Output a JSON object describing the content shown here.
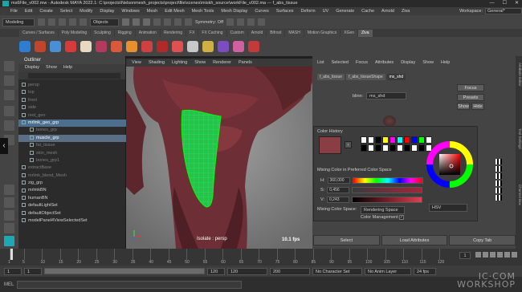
{
  "titlebar": {
    "title": "ms6File_v002.mw - Autodesk MAYA 2022.1: C:\\projects\\Nelsonmesh_projects\\project\\file\\scenes\\miskh_source\\workFile_v002.ma --- f_abs_tissue"
  },
  "window_controls": [
    "—",
    "☐",
    "✕"
  ],
  "menubar": {
    "items": [
      "File",
      "Edit",
      "Create",
      "Select",
      "Modify",
      "Display",
      "Windows",
      "Mesh",
      "Edit Mesh",
      "Mesh Tools",
      "Mesh Display",
      "Curves",
      "Surfaces",
      "Deform",
      "UV",
      "Generate",
      "Cache",
      "Arnold",
      "Ziva"
    ],
    "workspace_label": "Workspace:",
    "workspace_value": "General*"
  },
  "statusline": {
    "mode": "Modeling",
    "selection": "Objects",
    "symmetry": "Symmetry: Off"
  },
  "shelf_tabs": [
    "Curves / Surfaces",
    "Poly Modeling",
    "Sculpting",
    "Rigging",
    "Animation",
    "Rendering",
    "FX",
    "FX Caching",
    "Custom",
    "Arnold",
    "Bifrost",
    "MASH",
    "Motion Graphics",
    "XGen",
    "Ziva"
  ],
  "shelf_active_tab": "Ziva",
  "outliner": {
    "title": "Outliner",
    "menu": [
      "Display",
      "Show",
      "Help"
    ],
    "items": [
      {
        "label": "persp",
        "style": "dim"
      },
      {
        "label": "top",
        "style": "dim"
      },
      {
        "label": "front",
        "style": "dim"
      },
      {
        "label": "side",
        "style": "dim"
      },
      {
        "label": "rest_geo",
        "style": "dim"
      },
      {
        "label": "mrlmk_geo_grp",
        "style": "sel"
      },
      {
        "label": "bones_grp",
        "style": "dim"
      },
      {
        "label": "muscle_grp",
        "style": "hl"
      },
      {
        "label": "fat_tissue",
        "style": "dim"
      },
      {
        "label": "skin_mesh",
        "style": "dim"
      },
      {
        "label": "bones_grp1",
        "style": "dim"
      },
      {
        "label": "extractBase",
        "style": "dim"
      },
      {
        "label": "mrlmk_blend_Mesh",
        "style": "dim"
      },
      {
        "label": "zig_grp",
        "style": "normal"
      },
      {
        "label": "mrlmkBN",
        "style": "normal"
      },
      {
        "label": "humanBN",
        "style": "normal"
      },
      {
        "label": "defaultLightSet",
        "style": "normal"
      },
      {
        "label": "defaultObjectSet",
        "style": "normal"
      },
      {
        "label": "modelPanel4ViewSelectedSet",
        "style": "normal"
      }
    ]
  },
  "viewport": {
    "menu": [
      "View",
      "Shading",
      "Lighting",
      "Show",
      "Renderer",
      "Panels"
    ],
    "camera_label": "Isolate : persp",
    "fps": "10.1 fps"
  },
  "attribute_editor": {
    "menu": [
      "List",
      "Selected",
      "Focus",
      "Attributes",
      "Display",
      "Show",
      "Help"
    ],
    "tabs": [
      "f_abs_tissue",
      "f_abs_tissueShape",
      "ms_shd"
    ],
    "active_tab": "ms_shd",
    "node_label": "blinn:",
    "node_value": "ms_shd",
    "focus_label": "Focus",
    "presets_label": "Presets",
    "show_label": "Show",
    "hide_label": "Hide",
    "bottom_buttons": [
      "Select",
      "Load Attributes",
      "Copy Tab"
    ]
  },
  "color_picker": {
    "history_label": "Color History",
    "mixing_label": "Mixing Color in Preferred Color Space",
    "h_label": "H:",
    "h_value": "360,000",
    "s_label": "S:",
    "s_value": "0,456",
    "v_label": "V:",
    "v_value": "0,243",
    "mode_value": "HSV",
    "space_label": "Mixing Color Space:",
    "space_value": "Rendering Space",
    "management_label": "Color Management",
    "current_color": "#8a3d43",
    "history_colors": [
      "#ffffff",
      "#ffffff",
      "#000000",
      "#ffff00",
      "#ff00ff",
      "#00ffff",
      "#ff0000",
      "#0000ff",
      "#00ff00",
      "#ffffff",
      "#000000",
      "#ffffff",
      "#000000",
      "#ffffff",
      "#000000",
      "#ffffff",
      "#000000",
      "#ffffff",
      "#000000",
      "#ffffff"
    ]
  },
  "right_strip_labels": [
    "Attribute Editor",
    "Tool Settings",
    "Channel Box"
  ],
  "timeline": {
    "ticks": [
      "1",
      "5",
      "10",
      "15",
      "20",
      "25",
      "30",
      "35",
      "40",
      "45",
      "50",
      "55",
      "60",
      "65",
      "70",
      "75",
      "80",
      "85",
      "90",
      "95",
      "100",
      "105",
      "110",
      "115",
      "120"
    ],
    "current_frame": "1"
  },
  "range_slider": {
    "start": "1",
    "start_inner": "1",
    "end_inner": "120",
    "end": "120",
    "end2": "200",
    "character_set": "No Character Set",
    "anim_layer": "No Anim Layer",
    "fps": "24 fps"
  },
  "watermark": {
    "line1": "IC·COM",
    "line2": "WORKSHOP"
  }
}
